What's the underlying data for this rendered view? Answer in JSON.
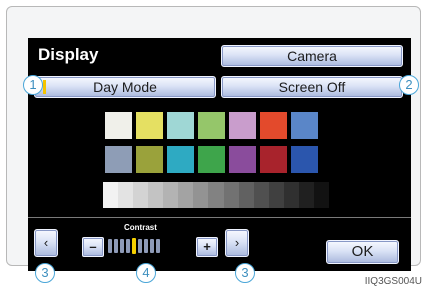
{
  "title": "Display",
  "buttons": {
    "camera": "Camera",
    "day_mode": "Day Mode",
    "screen_off": "Screen Off",
    "prev": "‹",
    "next": "›",
    "minus": "–",
    "plus": "+",
    "ok": "OK"
  },
  "contrast": {
    "label": "Contrast",
    "level": 5,
    "max": 9
  },
  "color_bars": {
    "row1": [
      "#f0f0ea",
      "#e5e062",
      "#9fd7d5",
      "#95c66a",
      "#c99dcc",
      "#e34a2c",
      "#5a86c8"
    ],
    "row2": [
      "#8e9db6",
      "#9aa23b",
      "#2eaac2",
      "#3ea54b",
      "#8a4c9c",
      "#a8232c",
      "#2b56ad"
    ],
    "grayscale_steps": [
      "#f2f2f2",
      "#e3e3e3",
      "#d3d3d3",
      "#c3c3c3",
      "#b3b3b3",
      "#a3a3a3",
      "#939393",
      "#828282",
      "#727272",
      "#616161",
      "#505050",
      "#404040",
      "#303030",
      "#202020",
      "#121212"
    ]
  },
  "callouts": {
    "c1": "1",
    "c2": "2",
    "c3a": "3",
    "c4": "4",
    "c3b": "3"
  },
  "figure_code": "IIQ3GS004U",
  "colors": {
    "indicator": "#f5c400",
    "callout_ring": "#4aa6d8"
  }
}
